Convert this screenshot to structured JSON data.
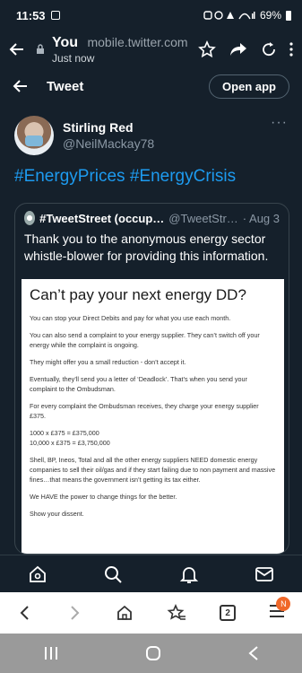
{
  "status_bar": {
    "time": "11:53",
    "battery": "69%"
  },
  "browser": {
    "title": "You",
    "url": "mobile.twitter.com",
    "subtitle": "Just now",
    "tab_count": "2",
    "menu_badge": "N"
  },
  "tweet_header": {
    "title": "Tweet",
    "open_app": "Open app"
  },
  "author": {
    "name": "Stirling Red",
    "handle": "@NeilMackay78",
    "more": "···"
  },
  "tweet_text": "#EnergyPrices #EnergyCrisis",
  "quote": {
    "name": "#TweetStreet (occup…",
    "handle": "@TweetStr…",
    "date": "· Aug 3",
    "text": "Thank you to the anonymous energy sector whistle-blower for providing this information."
  },
  "document": {
    "title": "Can’t pay your next energy DD?",
    "paragraphs": [
      "You can stop your Direct Debits and pay for what you use each month.",
      "You can also send a complaint to your energy supplier. They can’t switch off your energy while the complaint is ongoing.",
      "They might offer you a small reduction - don’t accept it.",
      "Eventually, they’ll send you a letter of ‘Deadlock’. That’s when you send your complaint to the Ombudsman.",
      "For every complaint the Ombudsman receives, they charge your energy supplier £375.",
      "1000 x £375 = £375,000\n10,000 x £375 = £3,750,000",
      "Shell, BP, Ineos, Total and all the other energy suppliers NEED domestic energy companies to sell their oil/gas and if they start failing due to non payment and massive fines…that means the government isn’t getting its tax either.",
      "We HAVE the power to change things for the better.",
      "Show your dissent."
    ]
  }
}
